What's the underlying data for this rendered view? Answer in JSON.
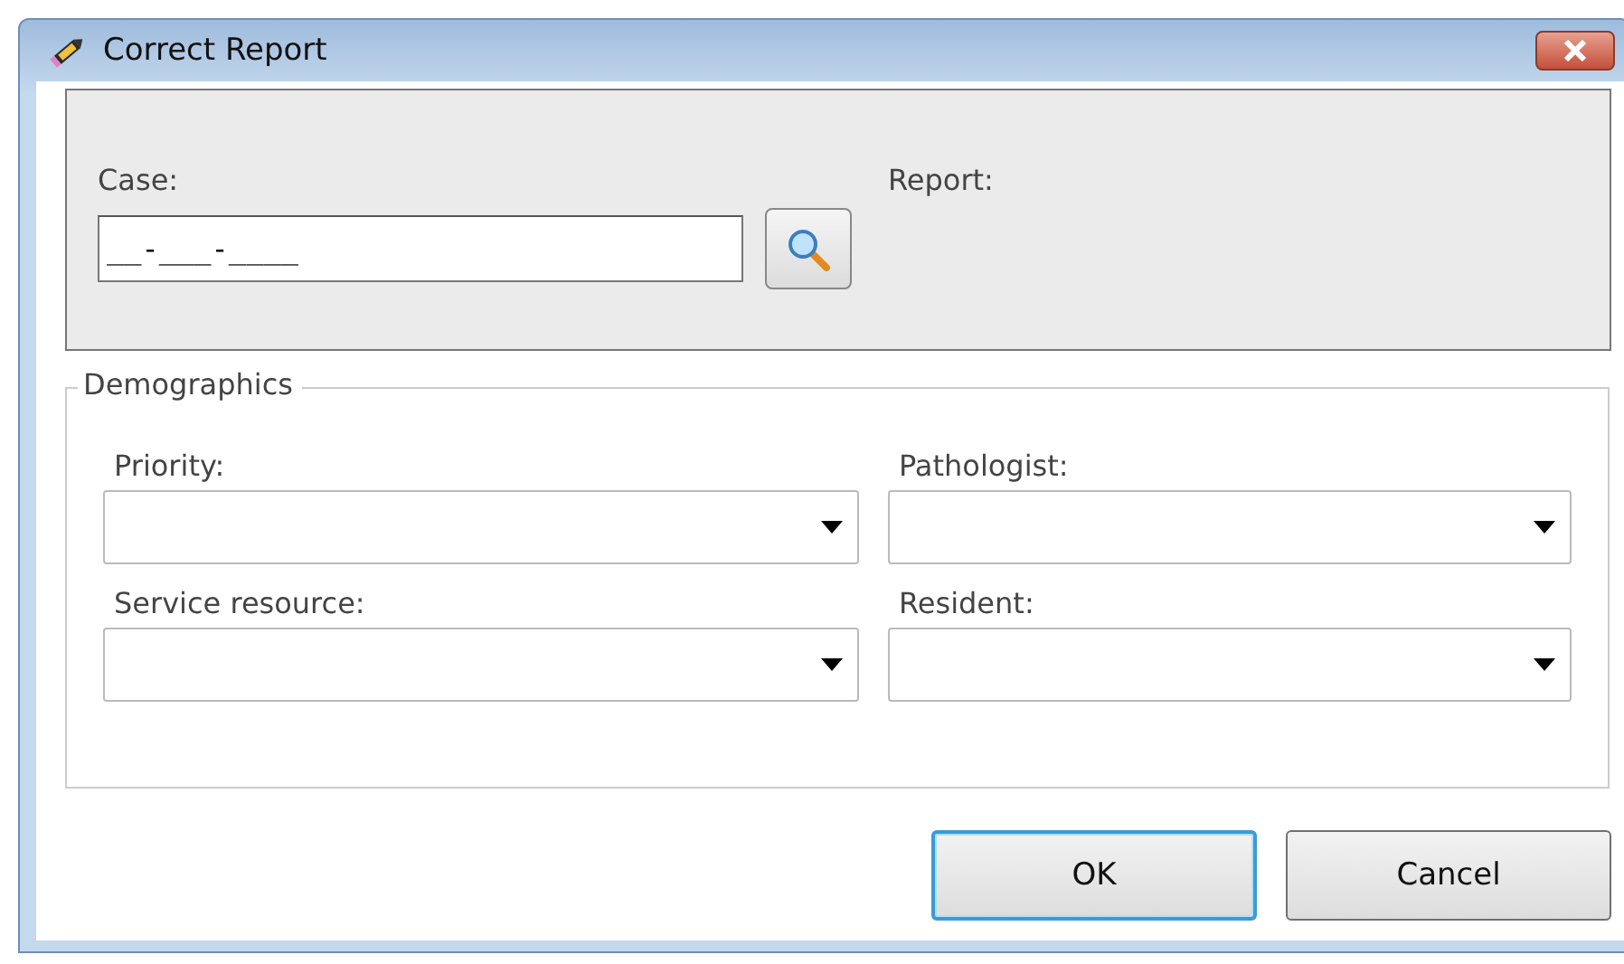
{
  "window": {
    "title": "Correct Report"
  },
  "case_panel": {
    "case_label": "Case:",
    "case_value": "__-___-____",
    "report_label": "Report:"
  },
  "demographics": {
    "title": "Demographics",
    "fields": [
      {
        "label": "Priority:"
      },
      {
        "label": "Pathologist:"
      },
      {
        "label": "Service resource:"
      },
      {
        "label": "Resident:"
      }
    ]
  },
  "buttons": [
    {
      "label": "OK",
      "focused": true
    },
    {
      "label": "Cancel",
      "focused": false
    }
  ]
}
